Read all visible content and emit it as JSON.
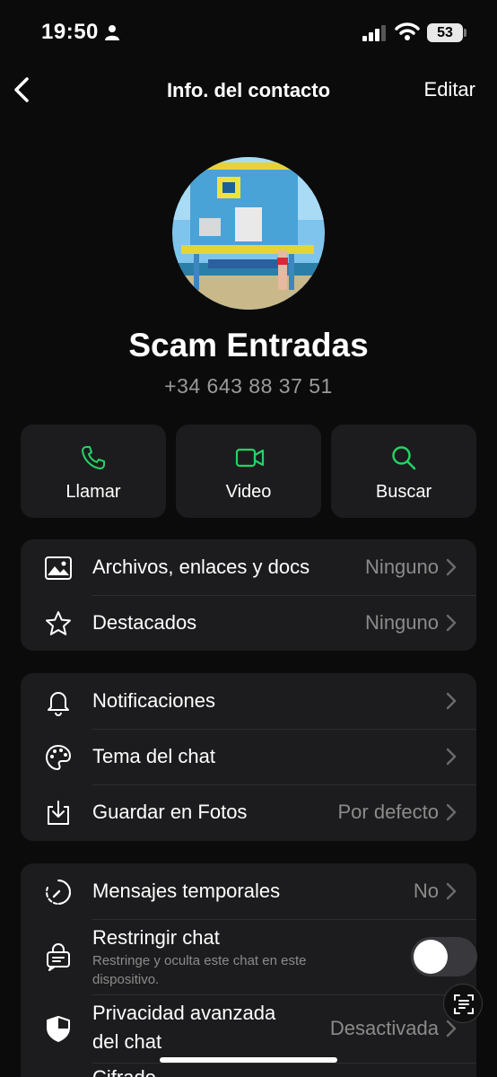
{
  "status": {
    "time": "19:50",
    "battery": "53"
  },
  "nav": {
    "title": "Info. del contacto",
    "edit": "Editar"
  },
  "contact": {
    "name": "Scam Entradas",
    "phone": "+34 643 88 37 51"
  },
  "actions": [
    {
      "label": "Llamar",
      "icon": "phone-icon"
    },
    {
      "label": "Video",
      "icon": "video-icon"
    },
    {
      "label": "Buscar",
      "icon": "search-icon"
    }
  ],
  "group1": [
    {
      "label": "Archivos, enlaces y docs",
      "value": "Ninguno",
      "icon": "image-icon"
    },
    {
      "label": "Destacados",
      "value": "Ninguno",
      "icon": "star-icon"
    }
  ],
  "group2": [
    {
      "label": "Notificaciones",
      "value": "",
      "icon": "bell-icon"
    },
    {
      "label": "Tema del chat",
      "value": "",
      "icon": "palette-icon"
    },
    {
      "label": "Guardar en Fotos",
      "value": "Por defecto",
      "icon": "download-icon"
    }
  ],
  "group3": {
    "temporales": {
      "label": "Mensajes temporales",
      "value": "No"
    },
    "restringir": {
      "label": "Restringir chat",
      "sub": "Restringe y oculta este chat en este dispositivo.",
      "enabled": false
    },
    "privacidad": {
      "label_line1": "Privacidad avanzada",
      "label_line2": "del chat",
      "value": "Desactivada"
    },
    "cifrado": {
      "label": "Cifrado"
    }
  },
  "colors": {
    "accent": "#25d366",
    "background": "#0b0b0b",
    "card": "#1c1c1e",
    "secondary_text": "#8b8b8b"
  }
}
